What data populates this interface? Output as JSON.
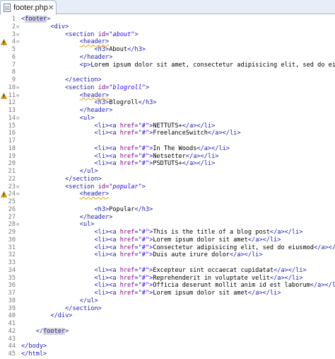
{
  "tab": {
    "label": "footer.php",
    "close": "✕"
  },
  "lines": [
    {
      "n": "1",
      "fold": "",
      "warn": false,
      "segs": [
        {
          "t": "<",
          "c": "tag"
        },
        {
          "t": "footer",
          "c": "tag hl"
        },
        {
          "t": ">",
          "c": "tag"
        }
      ]
    },
    {
      "n": "2",
      "fold": "⊖",
      "warn": false,
      "segs": [
        {
          "t": "        ",
          "c": ""
        },
        {
          "t": "<div>",
          "c": "tag"
        }
      ]
    },
    {
      "n": "3",
      "fold": "⊖",
      "warn": false,
      "segs": [
        {
          "t": "            ",
          "c": ""
        },
        {
          "t": "<section ",
          "c": "tag"
        },
        {
          "t": "id",
          "c": "attr"
        },
        {
          "t": "=",
          "c": "tag"
        },
        {
          "t": "\"about\"",
          "c": "str"
        },
        {
          "t": ">",
          "c": "tag"
        }
      ]
    },
    {
      "n": "4",
      "fold": "⊖",
      "warn": true,
      "segs": [
        {
          "t": "                ",
          "c": ""
        },
        {
          "t": "<header>",
          "c": "tag squig"
        }
      ]
    },
    {
      "n": "5",
      "fold": "",
      "warn": false,
      "segs": [
        {
          "t": "                    ",
          "c": ""
        },
        {
          "t": "<h3>",
          "c": "tag"
        },
        {
          "t": "About",
          "c": ""
        },
        {
          "t": "</h3>",
          "c": "tag"
        }
      ]
    },
    {
      "n": "6",
      "fold": "",
      "warn": false,
      "segs": [
        {
          "t": "                ",
          "c": ""
        },
        {
          "t": "</header>",
          "c": "tag"
        }
      ]
    },
    {
      "n": "7",
      "fold": "",
      "warn": false,
      "segs": [
        {
          "t": "                ",
          "c": ""
        },
        {
          "t": "<p>",
          "c": "tag"
        },
        {
          "t": "Lorem ipsum dolor sit amet, consectetur adipisicing elit, sed do eiusmod",
          "c": ""
        }
      ]
    },
    {
      "n": "8",
      "fold": "",
      "warn": false,
      "segs": []
    },
    {
      "n": "9",
      "fold": "",
      "warn": false,
      "segs": [
        {
          "t": "            ",
          "c": ""
        },
        {
          "t": "</section>",
          "c": "tag"
        }
      ]
    },
    {
      "n": "10",
      "fold": "⊖",
      "warn": false,
      "segs": [
        {
          "t": "            ",
          "c": ""
        },
        {
          "t": "<section ",
          "c": "tag"
        },
        {
          "t": "id",
          "c": "attr"
        },
        {
          "t": "=",
          "c": "tag"
        },
        {
          "t": "\"blogroll\"",
          "c": "str"
        },
        {
          "t": ">",
          "c": "tag"
        }
      ]
    },
    {
      "n": "11",
      "fold": "⊖",
      "warn": true,
      "segs": [
        {
          "t": "                ",
          "c": ""
        },
        {
          "t": "<header>",
          "c": "tag squig"
        }
      ]
    },
    {
      "n": "12",
      "fold": "",
      "warn": false,
      "segs": [
        {
          "t": "                    ",
          "c": ""
        },
        {
          "t": "<h3>",
          "c": "tag"
        },
        {
          "t": "Blogroll",
          "c": ""
        },
        {
          "t": "</h3>",
          "c": "tag"
        }
      ]
    },
    {
      "n": "13",
      "fold": "",
      "warn": false,
      "segs": [
        {
          "t": "                ",
          "c": ""
        },
        {
          "t": "</header>",
          "c": "tag"
        }
      ]
    },
    {
      "n": "14",
      "fold": "⊖",
      "warn": false,
      "segs": [
        {
          "t": "                ",
          "c": ""
        },
        {
          "t": "<ul>",
          "c": "tag"
        }
      ]
    },
    {
      "n": "15",
      "fold": "",
      "warn": false,
      "segs": [
        {
          "t": "                    ",
          "c": ""
        },
        {
          "t": "<li><a ",
          "c": "tag"
        },
        {
          "t": "href",
          "c": "attr"
        },
        {
          "t": "=",
          "c": "tag"
        },
        {
          "t": "\"#\"",
          "c": "str"
        },
        {
          "t": ">",
          "c": "tag"
        },
        {
          "t": "NETTUTS+",
          "c": ""
        },
        {
          "t": "</a></li>",
          "c": "tag"
        }
      ]
    },
    {
      "n": "16",
      "fold": "",
      "warn": false,
      "segs": [
        {
          "t": "                    ",
          "c": ""
        },
        {
          "t": "<li><a ",
          "c": "tag"
        },
        {
          "t": "href",
          "c": "attr"
        },
        {
          "t": "=",
          "c": "tag"
        },
        {
          "t": "\"#\"",
          "c": "str"
        },
        {
          "t": ">",
          "c": "tag"
        },
        {
          "t": "FreelanceSwitch",
          "c": ""
        },
        {
          "t": "</a></li>",
          "c": "tag"
        }
      ]
    },
    {
      "n": "17",
      "fold": "",
      "warn": false,
      "segs": []
    },
    {
      "n": "18",
      "fold": "",
      "warn": false,
      "segs": [
        {
          "t": "                    ",
          "c": ""
        },
        {
          "t": "<li><a ",
          "c": "tag"
        },
        {
          "t": "href",
          "c": "attr"
        },
        {
          "t": "=",
          "c": "tag"
        },
        {
          "t": "\"#\"",
          "c": "str"
        },
        {
          "t": ">",
          "c": "tag"
        },
        {
          "t": "In The Woods",
          "c": ""
        },
        {
          "t": "</a></li>",
          "c": "tag"
        }
      ]
    },
    {
      "n": "19",
      "fold": "",
      "warn": false,
      "segs": [
        {
          "t": "                    ",
          "c": ""
        },
        {
          "t": "<li><a ",
          "c": "tag"
        },
        {
          "t": "href",
          "c": "attr"
        },
        {
          "t": "=",
          "c": "tag"
        },
        {
          "t": "\"#\"",
          "c": "str"
        },
        {
          "t": ">",
          "c": "tag"
        },
        {
          "t": "Netsetter",
          "c": ""
        },
        {
          "t": "</a></li>",
          "c": "tag"
        }
      ]
    },
    {
      "n": "20",
      "fold": "",
      "warn": false,
      "segs": [
        {
          "t": "                    ",
          "c": ""
        },
        {
          "t": "<li><a ",
          "c": "tag"
        },
        {
          "t": "href",
          "c": "attr"
        },
        {
          "t": "=",
          "c": "tag"
        },
        {
          "t": "\"#\"",
          "c": "str"
        },
        {
          "t": ">",
          "c": "tag"
        },
        {
          "t": "PSDTUTS+",
          "c": ""
        },
        {
          "t": "</a></li>",
          "c": "tag"
        }
      ]
    },
    {
      "n": "21",
      "fold": "",
      "warn": false,
      "segs": [
        {
          "t": "                ",
          "c": ""
        },
        {
          "t": "</ul>",
          "c": "tag"
        }
      ]
    },
    {
      "n": "22",
      "fold": "",
      "warn": false,
      "segs": [
        {
          "t": "            ",
          "c": ""
        },
        {
          "t": "</section>",
          "c": "tag"
        }
      ]
    },
    {
      "n": "23",
      "fold": "⊖",
      "warn": false,
      "segs": [
        {
          "t": "            ",
          "c": ""
        },
        {
          "t": "<section ",
          "c": "tag"
        },
        {
          "t": "id",
          "c": "attr"
        },
        {
          "t": "=",
          "c": "tag"
        },
        {
          "t": "\"popular\"",
          "c": "str"
        },
        {
          "t": ">",
          "c": "tag"
        }
      ]
    },
    {
      "n": "24",
      "fold": "⊖",
      "warn": true,
      "segs": [
        {
          "t": "                ",
          "c": ""
        },
        {
          "t": "<header>",
          "c": "tag squig"
        }
      ]
    },
    {
      "n": "25",
      "fold": "",
      "warn": false,
      "segs": []
    },
    {
      "n": "26",
      "fold": "",
      "warn": false,
      "segs": [
        {
          "t": "                    ",
          "c": ""
        },
        {
          "t": "<h3>",
          "c": "tag"
        },
        {
          "t": "Popular",
          "c": ""
        },
        {
          "t": "</h3>",
          "c": "tag"
        }
      ]
    },
    {
      "n": "27",
      "fold": "",
      "warn": false,
      "segs": [
        {
          "t": "                ",
          "c": ""
        },
        {
          "t": "</header>",
          "c": "tag"
        }
      ]
    },
    {
      "n": "28",
      "fold": "⊖",
      "warn": false,
      "segs": [
        {
          "t": "                ",
          "c": ""
        },
        {
          "t": "<ul>",
          "c": "tag"
        }
      ]
    },
    {
      "n": "29",
      "fold": "",
      "warn": false,
      "segs": [
        {
          "t": "                    ",
          "c": ""
        },
        {
          "t": "<li><a ",
          "c": "tag"
        },
        {
          "t": "href",
          "c": "attr"
        },
        {
          "t": "=",
          "c": "tag"
        },
        {
          "t": "\"#\"",
          "c": "str"
        },
        {
          "t": ">",
          "c": "tag"
        },
        {
          "t": "This is the title of a blog post",
          "c": ""
        },
        {
          "t": "</a></li>",
          "c": "tag"
        }
      ]
    },
    {
      "n": "30",
      "fold": "",
      "warn": false,
      "segs": [
        {
          "t": "                    ",
          "c": ""
        },
        {
          "t": "<li><a ",
          "c": "tag"
        },
        {
          "t": "href",
          "c": "attr"
        },
        {
          "t": "=",
          "c": "tag"
        },
        {
          "t": "\"#\"",
          "c": "str"
        },
        {
          "t": ">",
          "c": "tag"
        },
        {
          "t": "Lorem ipsum dolor sit amet",
          "c": ""
        },
        {
          "t": "</a></li>",
          "c": "tag"
        }
      ]
    },
    {
      "n": "31",
      "fold": "",
      "warn": false,
      "segs": [
        {
          "t": "                    ",
          "c": ""
        },
        {
          "t": "<li><a ",
          "c": "tag"
        },
        {
          "t": "href",
          "c": "attr"
        },
        {
          "t": "=",
          "c": "tag"
        },
        {
          "t": "\"#\"",
          "c": "str"
        },
        {
          "t": ">",
          "c": "tag"
        },
        {
          "t": "Consectetur adipisicing elit, sed do eiusmod",
          "c": ""
        },
        {
          "t": "</a></li>",
          "c": "tag"
        }
      ]
    },
    {
      "n": "32",
      "fold": "",
      "warn": false,
      "segs": [
        {
          "t": "                    ",
          "c": ""
        },
        {
          "t": "<li><a ",
          "c": "tag"
        },
        {
          "t": "href",
          "c": "attr"
        },
        {
          "t": "=",
          "c": "tag"
        },
        {
          "t": "\"#\"",
          "c": "str"
        },
        {
          "t": ">",
          "c": "tag"
        },
        {
          "t": "Duis aute irure dolor",
          "c": ""
        },
        {
          "t": "</a></li>",
          "c": "tag"
        }
      ]
    },
    {
      "n": "33",
      "fold": "",
      "warn": false,
      "segs": []
    },
    {
      "n": "34",
      "fold": "",
      "warn": false,
      "segs": [
        {
          "t": "                    ",
          "c": ""
        },
        {
          "t": "<li><a ",
          "c": "tag"
        },
        {
          "t": "href",
          "c": "attr"
        },
        {
          "t": "=",
          "c": "tag"
        },
        {
          "t": "\"#\"",
          "c": "str"
        },
        {
          "t": ">",
          "c": "tag"
        },
        {
          "t": "Excepteur sint occaecat cupidatat",
          "c": ""
        },
        {
          "t": "</a></li>",
          "c": "tag"
        }
      ]
    },
    {
      "n": "35",
      "fold": "",
      "warn": false,
      "segs": [
        {
          "t": "                    ",
          "c": ""
        },
        {
          "t": "<li><a ",
          "c": "tag"
        },
        {
          "t": "href",
          "c": "attr"
        },
        {
          "t": "=",
          "c": "tag"
        },
        {
          "t": "\"#\"",
          "c": "str"
        },
        {
          "t": ">",
          "c": "tag"
        },
        {
          "t": "Reprehenderit in voluptate velit",
          "c": ""
        },
        {
          "t": "</a></li>",
          "c": "tag"
        }
      ]
    },
    {
      "n": "36",
      "fold": "",
      "warn": false,
      "segs": [
        {
          "t": "                    ",
          "c": ""
        },
        {
          "t": "<li><a ",
          "c": "tag"
        },
        {
          "t": "href",
          "c": "attr"
        },
        {
          "t": "=",
          "c": "tag"
        },
        {
          "t": "\"#\"",
          "c": "str"
        },
        {
          "t": ">",
          "c": "tag"
        },
        {
          "t": "Officia deserunt mollit anim id est laborum",
          "c": ""
        },
        {
          "t": "</a></li>",
          "c": "tag"
        }
      ]
    },
    {
      "n": "37",
      "fold": "",
      "warn": false,
      "segs": [
        {
          "t": "                    ",
          "c": ""
        },
        {
          "t": "<li><a ",
          "c": "tag"
        },
        {
          "t": "href",
          "c": "attr"
        },
        {
          "t": "=",
          "c": "tag"
        },
        {
          "t": "\"#\"",
          "c": "str"
        },
        {
          "t": ">",
          "c": "tag"
        },
        {
          "t": "Lorem ipsum dolor sit amet",
          "c": ""
        },
        {
          "t": "</a></li>",
          "c": "tag"
        }
      ]
    },
    {
      "n": "38",
      "fold": "",
      "warn": false,
      "segs": [
        {
          "t": "                ",
          "c": ""
        },
        {
          "t": "</ul>",
          "c": "tag"
        }
      ]
    },
    {
      "n": "39",
      "fold": "",
      "warn": false,
      "segs": [
        {
          "t": "            ",
          "c": ""
        },
        {
          "t": "</section>",
          "c": "tag"
        }
      ]
    },
    {
      "n": "40",
      "fold": "",
      "warn": false,
      "segs": [
        {
          "t": "        ",
          "c": ""
        },
        {
          "t": "</div>",
          "c": "tag"
        }
      ]
    },
    {
      "n": "41",
      "fold": "",
      "warn": false,
      "segs": []
    },
    {
      "n": "42",
      "fold": "",
      "warn": false,
      "segs": [
        {
          "t": "    ",
          "c": ""
        },
        {
          "t": "</",
          "c": "tag"
        },
        {
          "t": "footer",
          "c": "tag hl"
        },
        {
          "t": ">",
          "c": "tag"
        }
      ]
    },
    {
      "n": "43",
      "fold": "",
      "warn": false,
      "segs": []
    },
    {
      "n": "44",
      "fold": "",
      "warn": false,
      "segs": [
        {
          "t": "</body>",
          "c": "tag"
        }
      ]
    },
    {
      "n": "45",
      "fold": "",
      "warn": false,
      "segs": [
        {
          "t": "</html>",
          "c": "tag"
        }
      ]
    }
  ],
  "colors": {
    "tag": "#1b1baf",
    "attr": "#7f007f",
    "string": "#2a00ff",
    "warning": "#e2a400"
  }
}
